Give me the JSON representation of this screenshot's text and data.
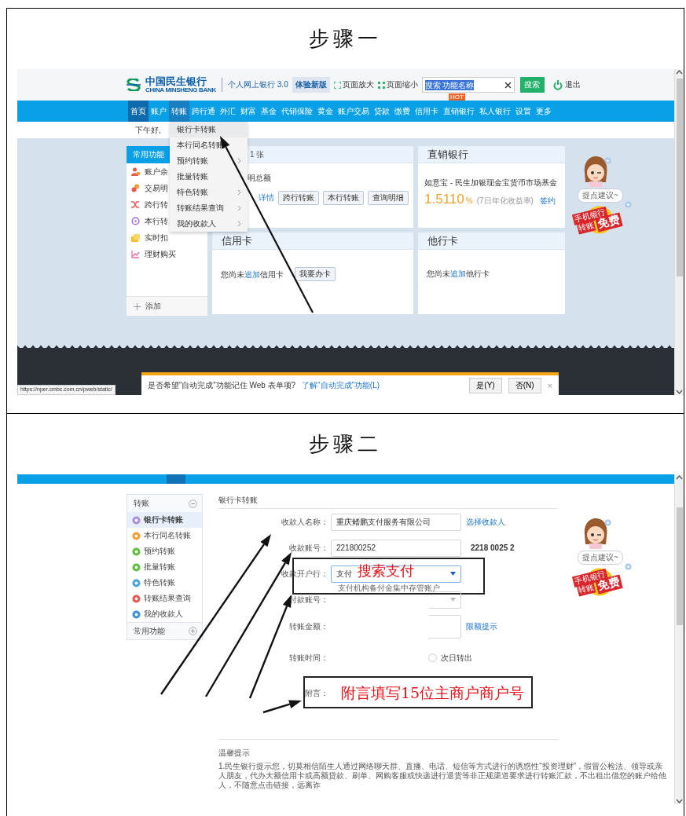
{
  "steps": [
    {
      "caption": "步骤一",
      "kind": "home",
      "header": {
        "logo_name": "中国民生银行",
        "logo_subtitle": "CHINA MINSHENG BANK",
        "product": "个人网上银行 3.0",
        "trial_button": "体验新版",
        "zoom_in": "页面放大",
        "zoom_out": "页面缩小",
        "search": {
          "value": "搜索 功能名称"
        },
        "search_button": "搜索",
        "logout": "退出"
      },
      "nav": [
        {
          "label": "首页",
          "selected": true,
          "expanded": false
        },
        {
          "label": "账户",
          "selected": false,
          "expanded": false
        },
        {
          "label": "转账",
          "selected": false,
          "expanded": true
        },
        {
          "label": "跨行通",
          "selected": false,
          "expanded": false
        },
        {
          "label": "外汇",
          "selected": false,
          "expanded": false
        },
        {
          "label": "财富",
          "selected": false,
          "expanded": false
        },
        {
          "label": "基金",
          "selected": false,
          "expanded": false
        },
        {
          "label": "代销保险",
          "selected": false,
          "expanded": false
        },
        {
          "label": "黄金",
          "selected": false,
          "expanded": false
        },
        {
          "label": "账户交易",
          "selected": false,
          "expanded": false
        },
        {
          "label": "贷款",
          "selected": false,
          "expanded": false
        },
        {
          "label": "缴费",
          "selected": false,
          "expanded": false
        },
        {
          "label": "信用卡",
          "selected": false,
          "expanded": false
        },
        {
          "label": "直销银行",
          "selected": false,
          "expanded": false,
          "badge": "HOT"
        },
        {
          "label": "私人银行",
          "selected": false,
          "expanded": false
        },
        {
          "label": "设置",
          "selected": false,
          "expanded": false
        },
        {
          "label": "更多",
          "selected": false,
          "expanded": false
        }
      ],
      "greeting": "下午好,",
      "dropdown": [
        {
          "label": "银行卡转账",
          "submenu": false
        },
        {
          "label": "本行同名转账",
          "submenu": false
        },
        {
          "label": "预约转账",
          "submenu": true
        },
        {
          "label": "批量转账",
          "submenu": false
        },
        {
          "label": "特色转账",
          "submenu": true
        },
        {
          "label": "转账结果查询",
          "submenu": true
        },
        {
          "label": "我的收款人",
          "submenu": true
        }
      ],
      "shortcuts": {
        "title": "常用功能",
        "items": [
          "账户余",
          "交易明",
          "跨行转",
          "本行转",
          "实时扣",
          "理财购买"
        ],
        "add": "添加"
      },
      "cards": [
        {
          "kind": "debit",
          "title": "1 张",
          "line": "明总额",
          "link": "详情",
          "buttons": [
            "跨行转账",
            "本行转账",
            "查询明细"
          ]
        },
        {
          "kind": "direct",
          "title": "直销银行",
          "product": "如意宝 - 民生加银现金宝货币市场基金",
          "rate": "1.5110",
          "unit": "%",
          "note": "(7日年化收益率)",
          "link": "签约"
        },
        {
          "kind": "credit",
          "title": "信用卡",
          "prefix": "您尚未",
          "link": "追加",
          "suffix": "信用卡",
          "button": "我要办卡"
        },
        {
          "kind": "other",
          "title": "他行卡",
          "prefix": "您尚未",
          "link": "追加",
          "suffix": "他行卡"
        }
      ],
      "assistant": {
        "bubble": "提点建议~",
        "promo_top": "手机银行",
        "promo_left": "转账",
        "promo_right": "免费"
      },
      "status_url": "https://nper.cmbc.com.cn/pweb/static/",
      "autocomplete": {
        "message": "是否希望“自动完成”功能记住 Web 表单项?",
        "link": "了解“自动完成”功能(L)",
        "buttons": [
          "是(Y)",
          "否(N)"
        ],
        "close": "×"
      }
    },
    {
      "caption": "步骤二",
      "kind": "transfer",
      "sidebar": [
        {
          "title": "转账",
          "expanded": true,
          "items": [
            {
              "label": "银行卡转账",
              "selected": true
            },
            {
              "label": "本行同名转账",
              "selected": false
            },
            {
              "label": "预约转账",
              "selected": false
            },
            {
              "label": "批量转账",
              "selected": false
            },
            {
              "label": "特色转账",
              "selected": false
            },
            {
              "label": "转账结果查询",
              "selected": false
            },
            {
              "label": "我的收款人",
              "selected": false
            }
          ]
        },
        {
          "title": "常用功能",
          "expanded": false
        }
      ],
      "form": {
        "title": "银行卡转账",
        "fields": [
          {
            "kind": "text",
            "label": "收款人名称：",
            "value": "重庆鳍鹏支付服务有限公司",
            "link": "选择收款人"
          },
          {
            "kind": "text",
            "label": "收款账号：",
            "value": "221800252",
            "aside": "2218 0025 2"
          },
          {
            "kind": "select",
            "label": "收款开户行：",
            "value": "支付",
            "hint": "支付机构备付金集中存管账户",
            "callout": "搜索支付"
          },
          {
            "kind": "select_partial",
            "label": "付款账号："
          },
          {
            "kind": "amount",
            "label": "转账金额：",
            "link": "限额提示"
          },
          {
            "kind": "radio",
            "label": "转账时间：",
            "option": "次日转出",
            "checked": false
          },
          {
            "kind": "memo",
            "label": "附言：",
            "callout": "附言填写15位主商户商户号"
          }
        ]
      },
      "tips": {
        "title": "温馨提示",
        "text": "1.民生银行提示您，切莫相信陌生人通过网络聊天群、直播、电话、短信等方式进行的诱惑性“投资理财”，假冒公检法、领导或亲人朋友，代办大额信用卡或高额贷款、刷单、网购客服或快递进行退货等非正规渠道要求进行转账汇款，不出租出借您的账户给他人，不随意点击链接，远离诈"
      },
      "assistant": {
        "bubble": "提点建议~",
        "promo_top": "手机银行",
        "promo_left": "转账",
        "promo_right": "免费"
      }
    }
  ]
}
